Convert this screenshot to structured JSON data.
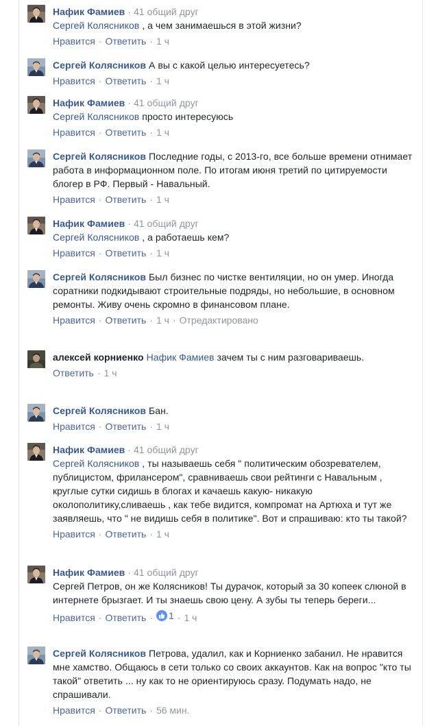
{
  "ui": {
    "like": "Нравится",
    "reply": "Ответить",
    "sep": "·",
    "mutual_sep": " · "
  },
  "comments": [
    {
      "author": "Нафик Фамиев",
      "mutual": "41 общий друг",
      "mention": "Сергей Колясников",
      "text": ", а чем занимаешься в этой жизни?",
      "time": "1 ч",
      "avatar": "nafik"
    },
    {
      "author": "Сергей Колясников",
      "text": "А вы с какой целью интересуетесь?",
      "time": "1 ч",
      "avatar": "sergey"
    },
    {
      "author": "Нафик Фамиев",
      "mutual": "41 общий друг",
      "mention": "Сергей Колясников",
      "text": "просто интересуюсь",
      "time": "1 ч",
      "avatar": "nafik"
    },
    {
      "author": "Сергей Колясников",
      "text": "Последние годы, с 2013-го, все больше времени отнимает работа в информационном поле. По итогам июня третий по цитируемости блогер в РФ. Первый - Навальный.",
      "time": "1 ч",
      "avatar": "sergey"
    },
    {
      "author": "Нафик Фамиев",
      "mutual": "41 общий друг",
      "mention": "Сергей Колясников",
      "text": ", а работаешь кем?",
      "time": "1 ч",
      "avatar": "nafik"
    },
    {
      "author": "Сергей Колясников",
      "text": "Был бизнес по чистке вентиляции, но он умер. Иногда соратники подкидывают строительные подряды, но небольшие, в основном ремонты. Живу очень скромно в финансовом плане.",
      "time": "1 ч",
      "edited": "Отредактировано",
      "avatar": "sergey"
    },
    {
      "author": "алексей корниенко",
      "mention": "Нафик Фамиев",
      "text": "зачем ты с ним разговариваешь.",
      "time": "1 ч",
      "avatar": "aleksey",
      "no_like": true
    },
    {
      "author": "Сергей Колясников",
      "text": "Бан.",
      "time": "1 ч",
      "avatar": "sergey"
    },
    {
      "author": "Нафик Фамиев",
      "mutual": "41 общий друг",
      "mention": "Сергей Колясников",
      "text": ", ты называешь себя \" политическим обозревателем, публицистом, фрилансером\", сравниваешь свои рейтинги с Навальным , круглые сутки сидишь в блогах и качаешь какую- никакую околополитику,сливаешь , как тебе видится, компромат на Артюха и тут же заявляешь, что \" не видишь себя в политике\". Вот и спрашиваю: кто ты такой?",
      "time": "1 ч",
      "avatar": "nafik"
    },
    {
      "author": "Нафик Фамиев",
      "mutual": "41 общий друг",
      "text": "Сергей Петров, он же Колясников! Ты дурачок, который за 30 копеек слюной в интернете брызгает. И ты знаешь свою цену. А зубы ты теперь береги...",
      "time": "1 ч",
      "likes": "1",
      "avatar": "nafik"
    },
    {
      "author": "Сергей Колясников",
      "text": "Петрова, удалил, как и Корниенко забанил. Не нравится мне хамство. Общаюсь в сети только со своих аккаунтов. Как на вопрос \"кто ты такой\" ответить ... ну как то не ориентируюсь сразу. Подумать надо, не спрашивали.",
      "time": "56 мин.",
      "avatar": "sergey"
    }
  ]
}
